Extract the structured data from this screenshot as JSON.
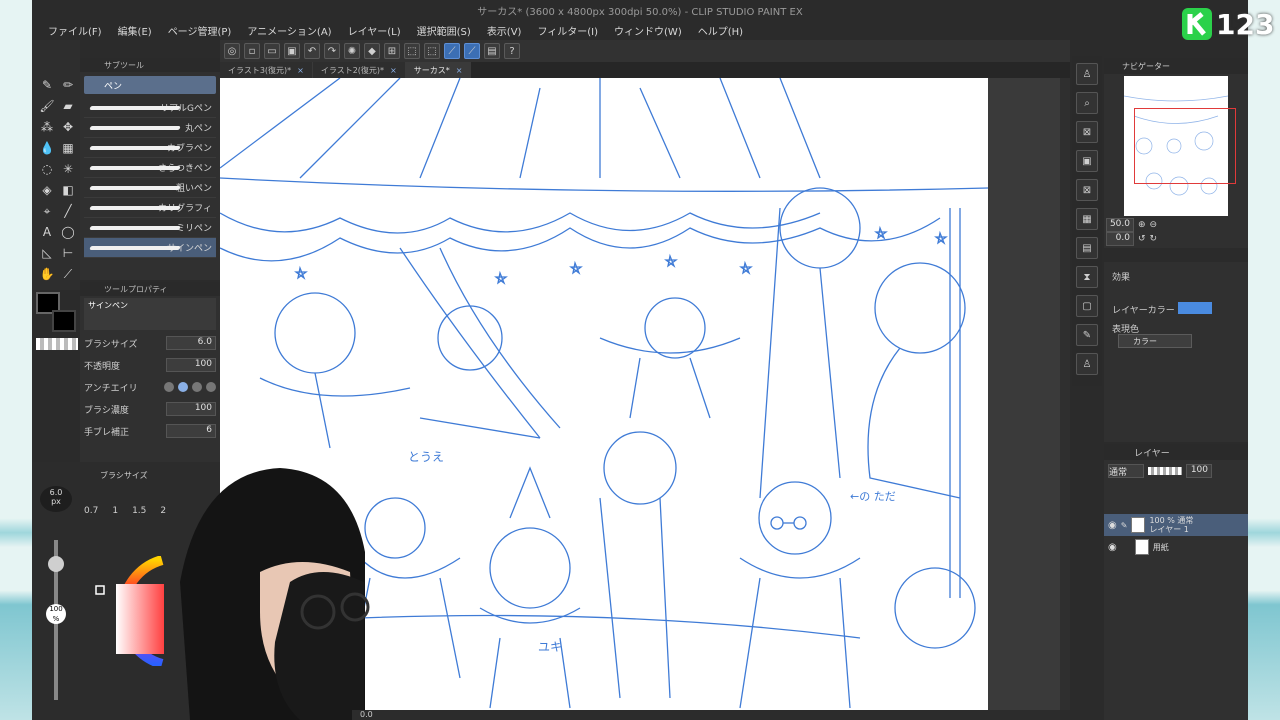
{
  "window": {
    "title": "サーカス* (3600 x 4800px 300dpi 50.0%)  - CLIP STUDIO PAINT EX"
  },
  "menu": [
    "ファイル(F)",
    "編集(E)",
    "ページ管理(P)",
    "アニメーション(A)",
    "レイヤー(L)",
    "選択範囲(S)",
    "表示(V)",
    "フィルター(I)",
    "ウィンドウ(W)",
    "ヘルプ(H)"
  ],
  "tabs": [
    {
      "label": "イラスト3(復元)*",
      "active": false
    },
    {
      "label": "イラスト2(復元)*",
      "active": false
    },
    {
      "label": "サーカス*",
      "active": true
    }
  ],
  "subtool": {
    "header": "サブツール",
    "selected": "ペン",
    "brushes": [
      "リアルGペン",
      "丸ペン",
      "カブラペン",
      "さらつきペン",
      "粗いペン",
      "カリグラフィ",
      "ミリペン",
      "サインペン"
    ]
  },
  "tool_property": {
    "header": "ツールプロパティ",
    "brush_name": "サインペン",
    "rows": [
      {
        "label": "ブラシサイズ",
        "value": "6.0"
      },
      {
        "label": "不透明度",
        "value": "100"
      },
      {
        "label": "アンチエイリ",
        "value": ""
      },
      {
        "label": "ブラシ濃度",
        "value": "100"
      },
      {
        "label": "手ブレ補正",
        "value": "6"
      }
    ]
  },
  "brush_size": {
    "header": "ブラシサイズ",
    "current": "6.0",
    "unit": "px",
    "presets": [
      "0.7",
      "1",
      "1.5",
      "2"
    ]
  },
  "opacity_pct": "100",
  "opacity_unit": "%",
  "navigator": {
    "header": "ナビゲーター",
    "zoom": "50.0",
    "rotate": "0.0"
  },
  "layer_property": {
    "effect_label": "効果",
    "layer_color_label": "レイヤーカラー",
    "display_color_label": "表現色",
    "display_color_value": "カラー",
    "layer_color": "#4a8be0"
  },
  "layers": {
    "header": "レイヤー",
    "blend": "通常",
    "opacity": "100",
    "items": [
      {
        "name": "100 % 通常",
        "sub": "レイヤー 1",
        "selected": true
      },
      {
        "name": "用紙",
        "sub": "",
        "selected": false
      }
    ]
  },
  "status": {
    "zoom": "0.0"
  },
  "logo": {
    "text": "123"
  },
  "colors": {
    "accent": "#3c6fb4",
    "sketch_line": "#3f7bd6"
  },
  "sketch_annotations": [
    "とうえ",
    "ユキ",
    "←の ただ"
  ]
}
